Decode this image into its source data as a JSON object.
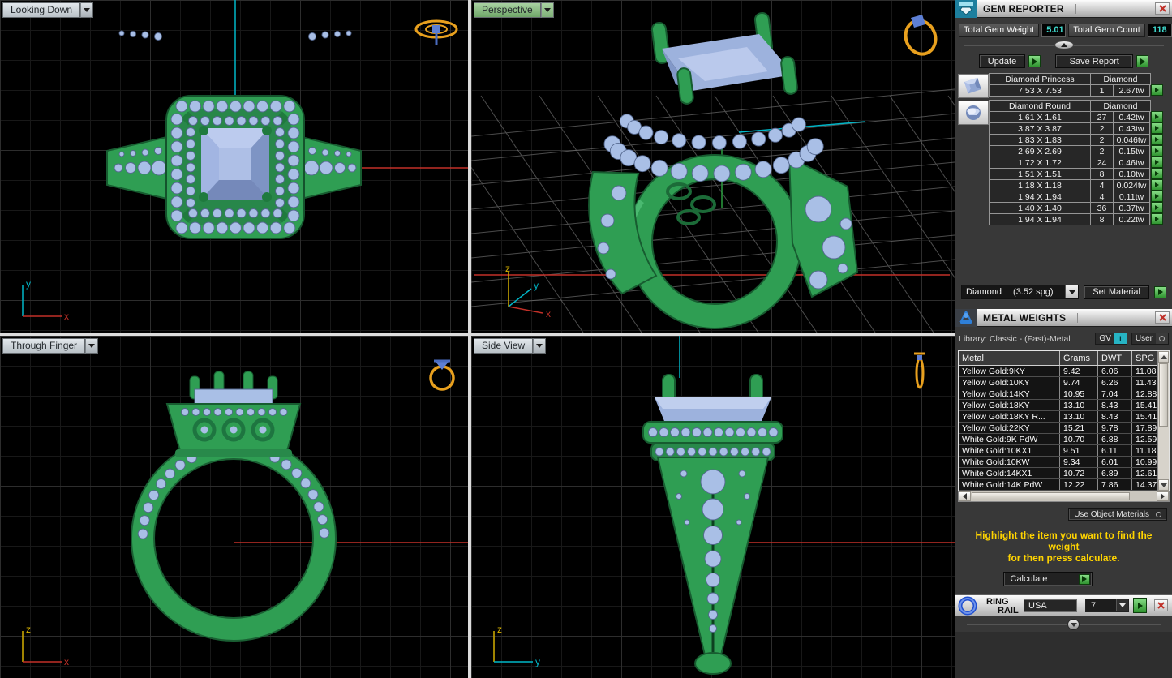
{
  "viewports": [
    {
      "label": "Looking Down",
      "axes": {
        "a": "y",
        "b": "x"
      }
    },
    {
      "label": "Perspective",
      "axes": {
        "a": "z",
        "b": "y",
        "c": "x"
      }
    },
    {
      "label": "Through Finger",
      "axes": {
        "a": "z",
        "b": "x"
      }
    },
    {
      "label": "Side View",
      "axes": {
        "a": "z",
        "b": "y"
      }
    }
  ],
  "gem_reporter": {
    "title": "GEM REPORTER",
    "totals": [
      {
        "label": "Total Gem Weight",
        "value": "5.01"
      },
      {
        "label": "Total Gem Count",
        "value": "118"
      }
    ],
    "update_label": "Update",
    "save_report_label": "Save Report",
    "groups": [
      {
        "icon": "princess-gem-icon",
        "type": "Diamond Princess",
        "material": "Diamond",
        "rows": [
          {
            "size": "7.53 X 7.53",
            "count": "1",
            "weight": "2.67tw"
          }
        ]
      },
      {
        "icon": "round-gem-icon",
        "type": "Diamond Round",
        "material": "Diamond",
        "rows": [
          {
            "size": "1.61 X 1.61",
            "count": "27",
            "weight": "0.42tw"
          },
          {
            "size": "3.87 X 3.87",
            "count": "2",
            "weight": "0.43tw"
          },
          {
            "size": "1.83 X 1.83",
            "count": "2",
            "weight": "0.046tw"
          },
          {
            "size": "2.69 X 2.69",
            "count": "2",
            "weight": "0.15tw"
          },
          {
            "size": "1.72 X 1.72",
            "count": "24",
            "weight": "0.46tw"
          },
          {
            "size": "1.51 X 1.51",
            "count": "8",
            "weight": "0.10tw"
          },
          {
            "size": "1.18 X 1.18",
            "count": "4",
            "weight": "0.024tw"
          },
          {
            "size": "1.94 X 1.94",
            "count": "4",
            "weight": "0.11tw"
          },
          {
            "size": "1.40 X 1.40",
            "count": "36",
            "weight": "0.37tw"
          },
          {
            "size": "1.94 X 1.94",
            "count": "8",
            "weight": "0.22tw"
          }
        ]
      }
    ],
    "material_name": "Diamond",
    "material_spg": "(3.52 spg)",
    "set_material_label": "Set Material"
  },
  "metal_weights": {
    "title": "METAL WEIGHTS",
    "library_label": "Library: Classic - (Fast)-Metal",
    "gv_label": "GV",
    "gv_state": "I",
    "user_label": "User",
    "table": {
      "headers": [
        "Metal",
        "Grams",
        "DWT",
        "SPG"
      ],
      "rows": [
        [
          "Yellow Gold:9KY",
          "9.42",
          "6.06",
          "11.08"
        ],
        [
          "Yellow Gold:10KY",
          "9.74",
          "6.26",
          "11.43"
        ],
        [
          "Yellow Gold:14KY",
          "10.95",
          "7.04",
          "12.88"
        ],
        [
          "Yellow Gold:18KY",
          "13.10",
          "8.43",
          "15.41"
        ],
        [
          "Yellow Gold:18KY R...",
          "13.10",
          "8.43",
          "15.41"
        ],
        [
          "Yellow Gold:22KY",
          "15.21",
          "9.78",
          "17.89"
        ],
        [
          "White Gold:9K PdW",
          "10.70",
          "6.88",
          "12.59"
        ],
        [
          "White Gold:10KX1",
          "9.51",
          "6.11",
          "11.18"
        ],
        [
          "White Gold:10KW",
          "9.34",
          "6.01",
          "10.99"
        ],
        [
          "White Gold:14KX1",
          "10.72",
          "6.89",
          "12.61"
        ],
        [
          "White Gold:14K PdW",
          "12.22",
          "7.86",
          "14.37"
        ]
      ]
    },
    "use_object_materials_label": "Use Object Materials",
    "hint_line1": "Highlight the item you want to find the weight",
    "hint_line2": "for then press calculate.",
    "calculate_label": "Calculate"
  },
  "ring_rail": {
    "title_line1": "RING",
    "title_line2": "RAIL",
    "region": "USA",
    "size": "7"
  },
  "colors": {
    "metal_green": "#2f9e53",
    "gem_blue": "#a9bfe6",
    "value_teal": "#3fd8cc",
    "hint_yellow": "#ffd400",
    "axis_x_red": "#c23028",
    "axis_y_cyan": "#00b7c8",
    "axis_z_yellow": "#d4af00",
    "active_view_green": "#8cc08c",
    "thumbnail_ring_orange": "#e8a01e"
  }
}
